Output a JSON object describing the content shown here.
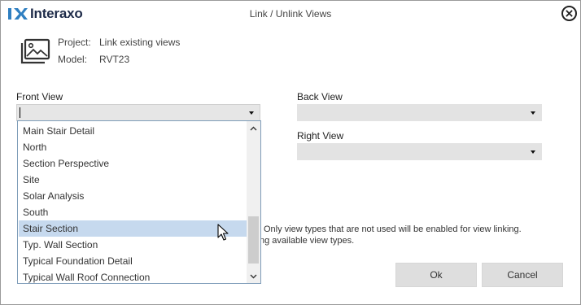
{
  "header": {
    "logo_text": "Interaxo",
    "title": "Link / Unlink Views",
    "close_icon": "close-circle-icon"
  },
  "project_info": {
    "icon": "picture-stack-icon",
    "project_label": "Project:",
    "project_value": "Link existing views",
    "model_label": "Model:",
    "model_value": "RVT23"
  },
  "fields": {
    "front_view": {
      "label": "Front View",
      "value": ""
    },
    "back_view": {
      "label": "Back View",
      "value": ""
    },
    "right_view": {
      "label": "Right View",
      "value": ""
    }
  },
  "dropdown": {
    "items": [
      "Main Stair Detail",
      "North",
      "Section Perspective",
      "Site",
      "Solar Analysis",
      "South",
      "Stair Section",
      "Typ. Wall Section",
      "Typical Foundation Detail",
      "Typical Wall Roof Connection"
    ],
    "selected": "Stair Section",
    "scroll_up_icon": "chevron-up-icon",
    "scroll_down_icon": "chevron-down-icon"
  },
  "notes": {
    "line1": "Only view types that are not used  will be enabled for view linking.",
    "line2": "ng available view types."
  },
  "buttons": {
    "ok": "Ok",
    "cancel": "Cancel"
  },
  "colors": {
    "brand": "#1e2b49",
    "logo_accent": "#2f7fc1",
    "selection": "#c6d9ee",
    "combo_bg": "#e3e3e3",
    "button_bg": "#dedede"
  }
}
